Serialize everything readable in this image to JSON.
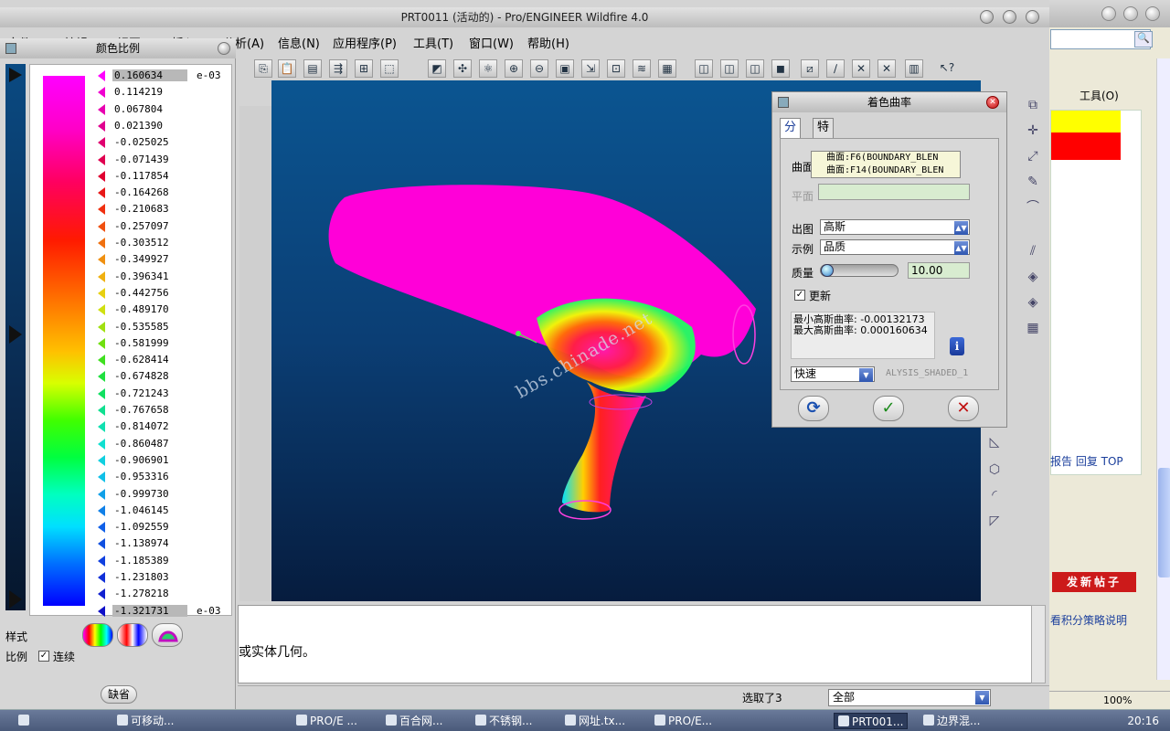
{
  "window": {
    "title": "PRT0011 (活动的) - Pro/ENGINEER Wildfire 4.0"
  },
  "menu": [
    {
      "label": "文件(F)"
    },
    {
      "label": "编辑(E)"
    },
    {
      "label": "视图(V)"
    },
    {
      "label": "插入(I)"
    },
    {
      "label": "分析(A)"
    },
    {
      "label": "信息(N)"
    },
    {
      "label": "应用程序(P)"
    },
    {
      "label": "工具(T)"
    },
    {
      "label": "窗口(W)"
    },
    {
      "label": "帮助(H)"
    }
  ],
  "scale_panel": {
    "title": "颜色比例",
    "exponent_top": "e-03",
    "exponent_bottom": "e-03",
    "values": [
      "0.160634",
      "0.114219",
      "0.067804",
      "0.021390",
      "-0.025025",
      "-0.071439",
      "-0.117854",
      "-0.164268",
      "-0.210683",
      "-0.257097",
      "-0.303512",
      "-0.349927",
      "-0.396341",
      "-0.442756",
      "-0.489170",
      "-0.535585",
      "-0.581999",
      "-0.628414",
      "-0.674828",
      "-0.721243",
      "-0.767658",
      "-0.814072",
      "-0.860487",
      "-0.906901",
      "-0.953316",
      "-0.999730",
      "-1.046145",
      "-1.092559",
      "-1.138974",
      "-1.185389",
      "-1.231803",
      "-1.278218",
      "-1.321731"
    ],
    "tick_colors": [
      "#ff00ff",
      "#f000d0",
      "#e800b0",
      "#e00090",
      "#e00070",
      "#e00050",
      "#e00030",
      "#e81818",
      "#f03010",
      "#f05010",
      "#f07010",
      "#f09010",
      "#f0b010",
      "#e8d010",
      "#d0e010",
      "#a0e010",
      "#70e010",
      "#40e020",
      "#20e040",
      "#10e060",
      "#10e090",
      "#10e0b0",
      "#10e0d0",
      "#10d0e0",
      "#10c0e8",
      "#10a0e8",
      "#1080e8",
      "#1060e8",
      "#1050e0",
      "#1040e0",
      "#1030d8",
      "#1020d0",
      "#1010c8"
    ],
    "style_label": "样式",
    "ratio_label": "比例",
    "continuous_label": "连续",
    "continuous_checked": "✓",
    "default_button": "缺省"
  },
  "dialog": {
    "title": "着色曲率",
    "tabs": [
      "分析",
      "特征"
    ],
    "surface_label": "曲面",
    "surfaces": [
      "曲面:F6(BOUNDARY_BLEN",
      "曲面:F14(BOUNDARY_BLEN"
    ],
    "plane_label": "平面",
    "plot_label": "出图",
    "plot_value": "高斯",
    "sample_label": "示例",
    "sample_value": "品质",
    "quality_label": "质量",
    "quality_value": "10.00",
    "quality_fraction": 0.0,
    "update_label": "更新",
    "update_checked": "✓",
    "min_label": "最小高斯曲率:",
    "min_value": "-0.00132173",
    "max_label": "最大高斯曲率:",
    "max_value": "0.000160634",
    "mode_value": "快速",
    "analysis_name": "ALYSIS_SHADED_1"
  },
  "message_area": {
    "text": "或实体几何。"
  },
  "status": {
    "selected": "选取了3",
    "filter": "全部"
  },
  "watermark": "bbs.chinade.net",
  "browser": {
    "toolbar_label": "工具(O)",
    "links": "报告  回复  TOP",
    "post_button": "发新帖子",
    "note": "看积分策略说明",
    "zoom": "100%"
  },
  "taskbar": {
    "items": [
      "可移动...",
      "PRO/E ...",
      "百合网...",
      "不锈钢...",
      "网址.tx...",
      "PRO/E...",
      "PRT001...",
      "边界混..."
    ],
    "clock": "20:16"
  }
}
